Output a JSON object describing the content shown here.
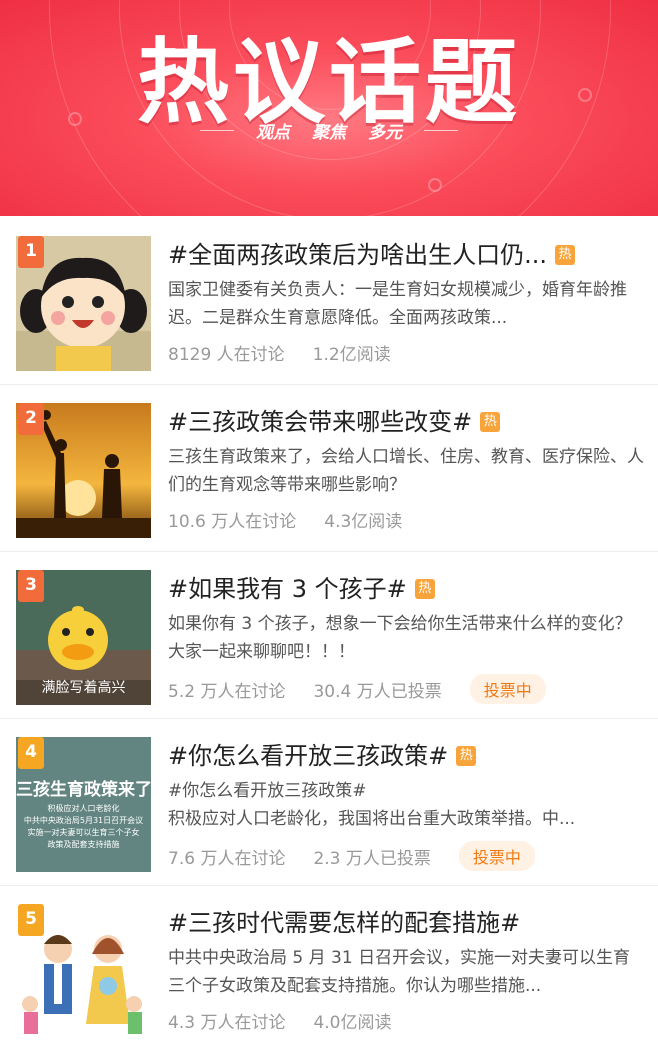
{
  "banner": {
    "title": "热议话题",
    "subtitles": [
      "观点",
      "聚焦",
      "多元"
    ]
  },
  "topics": [
    {
      "rank": "1",
      "rank_color": "#f26b3a",
      "title": "#全面两孩政策后为啥出生人口仍...",
      "hot": "热",
      "desc": "国家卫健委有关负责人：一是生育妇女规模减少，婚育年龄推迟。二是群众生育意愿降低。全面两孩政策...",
      "discuss": "8129 人在讨论",
      "reads": "1.2亿阅读",
      "thumb_icon": "girl-cartoon-icon"
    },
    {
      "rank": "2",
      "rank_color": "#f26b3a",
      "title": "#三孩政策会带来哪些改变#",
      "hot": "热",
      "desc": "三孩生育政策来了，会给人口增长、住房、教育、医疗保险、人们的生育观念等带来哪些影响？",
      "discuss": "10.6 万人在讨论",
      "reads": "4.3亿阅读",
      "thumb_icon": "family-silhouette-icon"
    },
    {
      "rank": "3",
      "rank_color": "#f26b3a",
      "title": "#如果我有 3 个孩子#",
      "hot": "热",
      "desc": "如果你有 3 个孩子，想象一下会给你生活带来什么样的变化？大家一起来聊聊吧！！！",
      "discuss": "5.2 万人在讨论",
      "reads": "30.4 万人已投票",
      "vote": "投票中",
      "thumb_caption": "满脸写着高兴",
      "thumb_icon": "duck-icon"
    },
    {
      "rank": "4",
      "rank_color": "#f5a623",
      "title": "#你怎么看开放三孩政策#",
      "hot": "热",
      "tag_line": "#你怎么看开放三孩政策#",
      "desc": "积极应对人口老龄化，我国将出台重大政策举措。中...",
      "discuss": "7.6 万人在讨论",
      "reads": "2.3 万人已投票",
      "vote": "投票中",
      "thumb_title": "三孩生育政策来了",
      "thumb_lines": [
        "积极应对人口老龄化",
        "中共中央政治局5月31日召开会议",
        "实施一对夫妻可以生育三个子女",
        "政策及配套支持措施"
      ],
      "thumb_icon": "policy-poster-icon"
    },
    {
      "rank": "5",
      "rank_color": "#f5a623",
      "title": "#三孩时代需要怎样的配套措施#",
      "desc": "中共中央政治局 5 月 31 日召开会议，实施一对夫妻可以生育三个子女政策及配套支持措施。你认为哪些措施...",
      "discuss": "4.3 万人在讨论",
      "reads": "4.0亿阅读",
      "thumb_icon": "family-cartoon-icon"
    }
  ]
}
